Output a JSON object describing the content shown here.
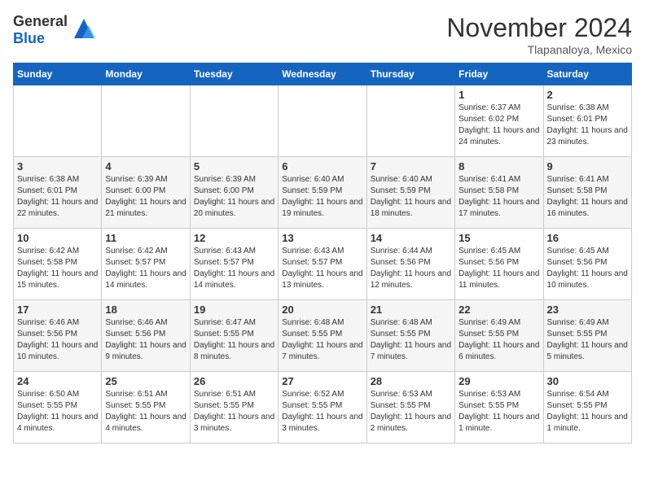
{
  "header": {
    "logo_line1": "General",
    "logo_line2": "Blue",
    "month_title": "November 2024",
    "location": "Tlapanaloya, Mexico"
  },
  "days_of_week": [
    "Sunday",
    "Monday",
    "Tuesday",
    "Wednesday",
    "Thursday",
    "Friday",
    "Saturday"
  ],
  "weeks": [
    [
      {
        "day": "",
        "info": ""
      },
      {
        "day": "",
        "info": ""
      },
      {
        "day": "",
        "info": ""
      },
      {
        "day": "",
        "info": ""
      },
      {
        "day": "",
        "info": ""
      },
      {
        "day": "1",
        "info": "Sunrise: 6:37 AM\nSunset: 6:02 PM\nDaylight: 11 hours and 24 minutes."
      },
      {
        "day": "2",
        "info": "Sunrise: 6:38 AM\nSunset: 6:01 PM\nDaylight: 11 hours and 23 minutes."
      }
    ],
    [
      {
        "day": "3",
        "info": "Sunrise: 6:38 AM\nSunset: 6:01 PM\nDaylight: 11 hours and 22 minutes."
      },
      {
        "day": "4",
        "info": "Sunrise: 6:39 AM\nSunset: 6:00 PM\nDaylight: 11 hours and 21 minutes."
      },
      {
        "day": "5",
        "info": "Sunrise: 6:39 AM\nSunset: 6:00 PM\nDaylight: 11 hours and 20 minutes."
      },
      {
        "day": "6",
        "info": "Sunrise: 6:40 AM\nSunset: 5:59 PM\nDaylight: 11 hours and 19 minutes."
      },
      {
        "day": "7",
        "info": "Sunrise: 6:40 AM\nSunset: 5:59 PM\nDaylight: 11 hours and 18 minutes."
      },
      {
        "day": "8",
        "info": "Sunrise: 6:41 AM\nSunset: 5:58 PM\nDaylight: 11 hours and 17 minutes."
      },
      {
        "day": "9",
        "info": "Sunrise: 6:41 AM\nSunset: 5:58 PM\nDaylight: 11 hours and 16 minutes."
      }
    ],
    [
      {
        "day": "10",
        "info": "Sunrise: 6:42 AM\nSunset: 5:58 PM\nDaylight: 11 hours and 15 minutes."
      },
      {
        "day": "11",
        "info": "Sunrise: 6:42 AM\nSunset: 5:57 PM\nDaylight: 11 hours and 14 minutes."
      },
      {
        "day": "12",
        "info": "Sunrise: 6:43 AM\nSunset: 5:57 PM\nDaylight: 11 hours and 14 minutes."
      },
      {
        "day": "13",
        "info": "Sunrise: 6:43 AM\nSunset: 5:57 PM\nDaylight: 11 hours and 13 minutes."
      },
      {
        "day": "14",
        "info": "Sunrise: 6:44 AM\nSunset: 5:56 PM\nDaylight: 11 hours and 12 minutes."
      },
      {
        "day": "15",
        "info": "Sunrise: 6:45 AM\nSunset: 5:56 PM\nDaylight: 11 hours and 11 minutes."
      },
      {
        "day": "16",
        "info": "Sunrise: 6:45 AM\nSunset: 5:56 PM\nDaylight: 11 hours and 10 minutes."
      }
    ],
    [
      {
        "day": "17",
        "info": "Sunrise: 6:46 AM\nSunset: 5:56 PM\nDaylight: 11 hours and 10 minutes."
      },
      {
        "day": "18",
        "info": "Sunrise: 6:46 AM\nSunset: 5:56 PM\nDaylight: 11 hours and 9 minutes."
      },
      {
        "day": "19",
        "info": "Sunrise: 6:47 AM\nSunset: 5:55 PM\nDaylight: 11 hours and 8 minutes."
      },
      {
        "day": "20",
        "info": "Sunrise: 6:48 AM\nSunset: 5:55 PM\nDaylight: 11 hours and 7 minutes."
      },
      {
        "day": "21",
        "info": "Sunrise: 6:48 AM\nSunset: 5:55 PM\nDaylight: 11 hours and 7 minutes."
      },
      {
        "day": "22",
        "info": "Sunrise: 6:49 AM\nSunset: 5:55 PM\nDaylight: 11 hours and 6 minutes."
      },
      {
        "day": "23",
        "info": "Sunrise: 6:49 AM\nSunset: 5:55 PM\nDaylight: 11 hours and 5 minutes."
      }
    ],
    [
      {
        "day": "24",
        "info": "Sunrise: 6:50 AM\nSunset: 5:55 PM\nDaylight: 11 hours and 4 minutes."
      },
      {
        "day": "25",
        "info": "Sunrise: 6:51 AM\nSunset: 5:55 PM\nDaylight: 11 hours and 4 minutes."
      },
      {
        "day": "26",
        "info": "Sunrise: 6:51 AM\nSunset: 5:55 PM\nDaylight: 11 hours and 3 minutes."
      },
      {
        "day": "27",
        "info": "Sunrise: 6:52 AM\nSunset: 5:55 PM\nDaylight: 11 hours and 3 minutes."
      },
      {
        "day": "28",
        "info": "Sunrise: 6:53 AM\nSunset: 5:55 PM\nDaylight: 11 hours and 2 minutes."
      },
      {
        "day": "29",
        "info": "Sunrise: 6:53 AM\nSunset: 5:55 PM\nDaylight: 11 hours and 1 minute."
      },
      {
        "day": "30",
        "info": "Sunrise: 6:54 AM\nSunset: 5:55 PM\nDaylight: 11 hours and 1 minute."
      }
    ]
  ]
}
